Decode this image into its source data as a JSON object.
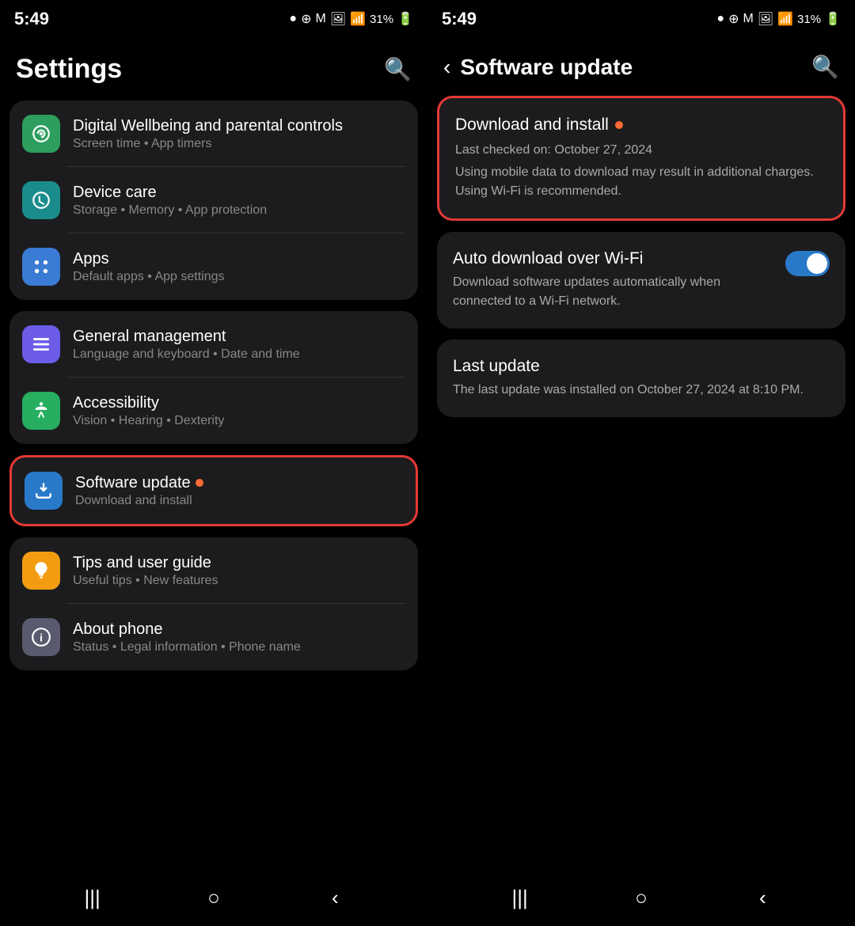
{
  "left_status": {
    "time": "5:49",
    "battery": "31%"
  },
  "right_status": {
    "time": "5:49",
    "battery": "31%"
  },
  "left_panel": {
    "title": "Settings",
    "search_icon": "🔍",
    "items_card1": [
      {
        "name": "Digital Wellbeing and parental controls",
        "sub": "Screen time  •  App timers",
        "icon_char": "🌿",
        "icon_class": "icon-green"
      },
      {
        "name": "Device care",
        "sub": "Storage  •  Memory  •  App protection",
        "icon_char": "⟳",
        "icon_class": "icon-teal"
      },
      {
        "name": "Apps",
        "sub": "Default apps  •  App settings",
        "icon_char": "⠿",
        "icon_class": "icon-blue-dots"
      }
    ],
    "items_card2": [
      {
        "name": "General management",
        "sub": "Language and keyboard  •  Date and time",
        "icon_char": "≡",
        "icon_class": "icon-purple"
      },
      {
        "name": "Accessibility",
        "sub": "Vision  •  Hearing  •  Dexterity",
        "icon_char": "♿",
        "icon_class": "icon-green2"
      }
    ],
    "software_update": {
      "name": "Software update",
      "sub": "Download and install",
      "icon_char": "↺",
      "icon_class": "icon-blue-update",
      "has_dot": true
    },
    "items_card3": [
      {
        "name": "Tips and user guide",
        "sub": "Useful tips  •  New features",
        "icon_char": "💡",
        "icon_class": "icon-yellow"
      },
      {
        "name": "About phone",
        "sub": "Status  •  Legal information  •  Phone name",
        "icon_char": "ℹ",
        "icon_class": "icon-gray"
      }
    ]
  },
  "right_panel": {
    "title": "Software update",
    "back_label": "‹",
    "search_icon": "🔍",
    "download_install": {
      "title": "Download and install",
      "has_dot": true,
      "desc_line1": "Last checked on: October 27, 2024",
      "desc_line2": "Using mobile data to download may result in additional charges. Using Wi-Fi is recommended."
    },
    "auto_download": {
      "title": "Auto download over Wi-Fi",
      "desc": "Download software updates automatically when connected to a Wi-Fi network.",
      "toggle_on": true
    },
    "last_update": {
      "title": "Last update",
      "desc": "The last update was installed on October 27, 2024 at 8:10 PM."
    }
  },
  "nav": {
    "left": [
      "|||",
      "○",
      "‹"
    ],
    "right": [
      "|||",
      "○",
      "‹"
    ]
  }
}
